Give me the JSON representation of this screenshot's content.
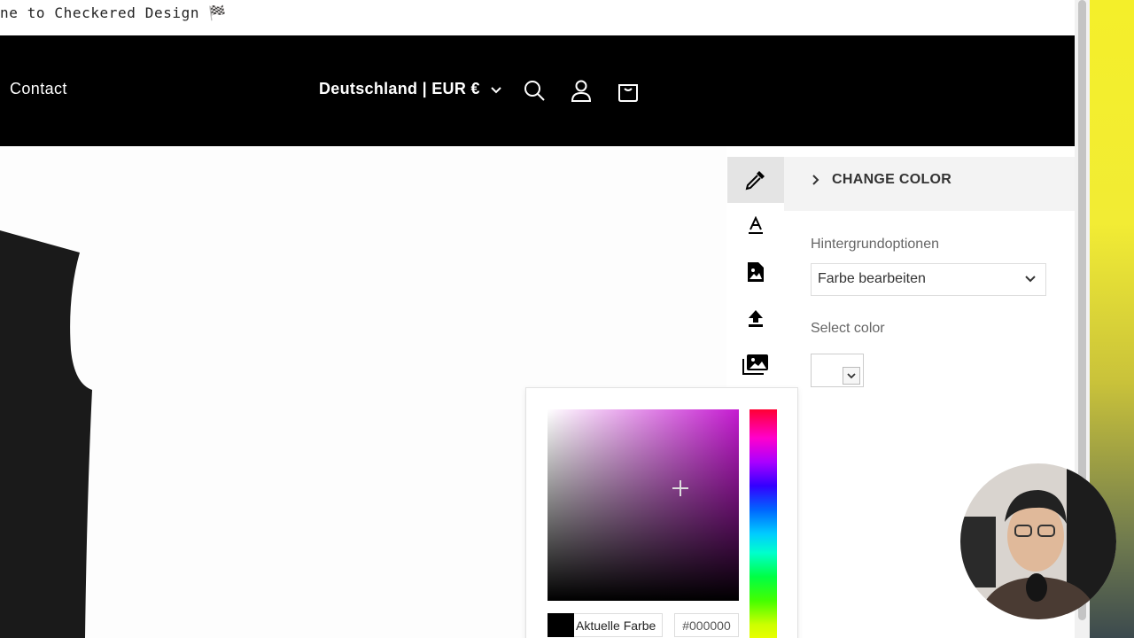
{
  "announcement": {
    "text": "ne to Checkered Design 🏁"
  },
  "header": {
    "nav_contact": "Contact",
    "country_selector": "Deutschland | EUR €",
    "icons": [
      "search-icon",
      "account-icon",
      "cart-icon"
    ]
  },
  "tools": {
    "items": [
      "eyedropper-icon",
      "text-icon",
      "image-file-icon",
      "upload-icon",
      "gallery-icon"
    ],
    "active": "eyedropper-icon"
  },
  "panel": {
    "title": "CHANGE COLOR",
    "background_label": "Hintergrundoptionen",
    "background_select": "Farbe bearbeiten",
    "select_color_label": "Select color"
  },
  "picker": {
    "current_label": "Aktuelle Farbe",
    "hex_value": "#000000",
    "current_color": "#000000",
    "hue_color": "#c51bd1"
  },
  "colors": {
    "header_bg": "#000000",
    "side_accent": "#f4ef2a"
  }
}
